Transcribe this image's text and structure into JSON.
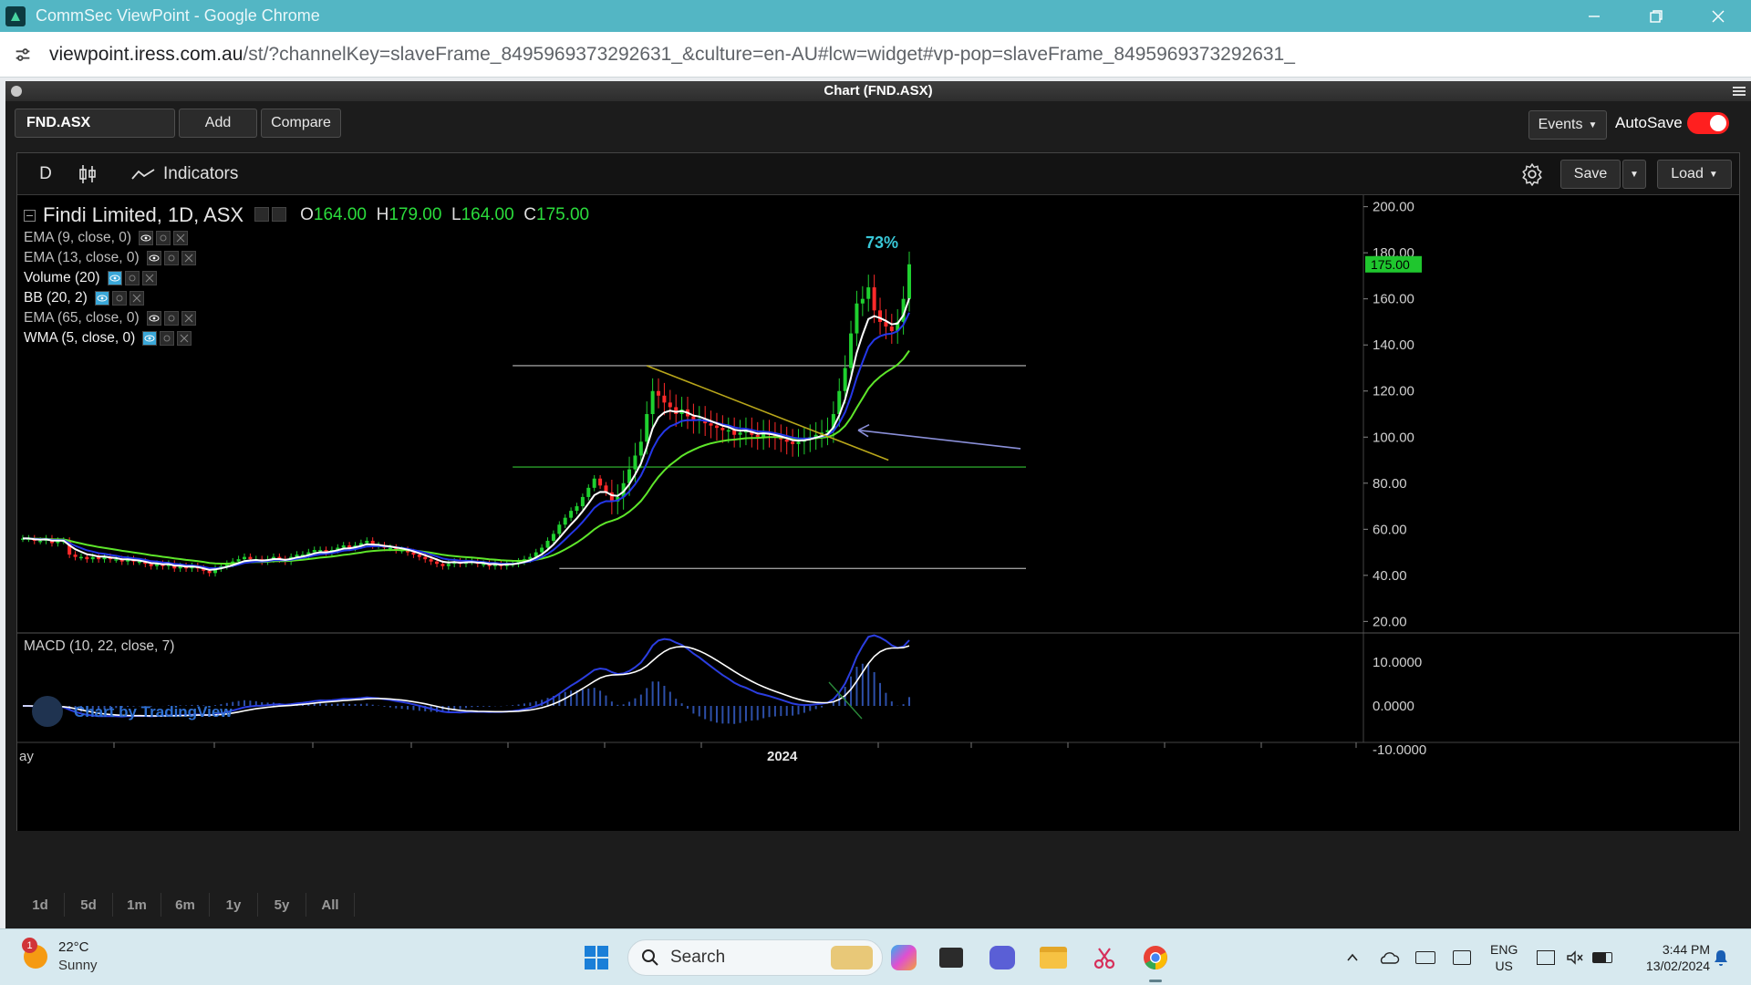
{
  "window": {
    "title": "CommSec ViewPoint - Google Chrome",
    "url_host": "viewpoint.iress.com.au",
    "url_path": "/st/?channelKey=slaveFrame_8495969373292631_&culture=en-AU#lcw=widget#vp-pop=slaveFrame_8495969373292631_"
  },
  "panel": {
    "title": "Chart (FND.ASX)"
  },
  "toolbar": {
    "symbol_value": "FND.ASX",
    "add_label": "Add",
    "compare_label": "Compare",
    "events_label": "Events",
    "autosave_label": "AutoSave",
    "autosave_on": true,
    "interval_label": "D",
    "indicators_label": "Indicators",
    "save_label": "Save",
    "load_label": "Load"
  },
  "legend": {
    "instrument": "Findi Limited, 1D, ASX",
    "ohlc": {
      "o_label": "O",
      "o": "164.00",
      "h_label": "H",
      "h": "179.00",
      "l_label": "L",
      "l": "164.00",
      "c_label": "C",
      "c": "175.00"
    },
    "indicators": [
      {
        "label": "EMA (9, close, 0)",
        "visible": false
      },
      {
        "label": "EMA (13, close, 0)",
        "visible": false
      },
      {
        "label": "Volume (20)",
        "visible": true
      },
      {
        "label": "BB (20, 2)",
        "visible": true
      },
      {
        "label": "EMA (65, close, 0)",
        "visible": false
      },
      {
        "label": "WMA (5, close, 0)",
        "visible": true
      }
    ],
    "macd_label": "MACD (10, 22, close, 7)"
  },
  "chart_data": {
    "type": "candlestick",
    "price_axis": {
      "ticks": [
        "200.00",
        "180.00",
        "160.00",
        "140.00",
        "120.00",
        "100.00",
        "80.00",
        "60.00",
        "40.00",
        "20.00"
      ],
      "range": [
        15,
        205
      ]
    },
    "last_price_label": "175.00",
    "annotation": "73%",
    "macd_axis": {
      "ticks": [
        "10.0000",
        "0.0000",
        "-10.0000"
      ]
    },
    "time_axis": {
      "labels": [
        "ay",
        "2024"
      ]
    },
    "watermark": "Chart by TradingView",
    "horizontal_levels": [
      131,
      87,
      43
    ],
    "trendline": {
      "from": 131,
      "to": 90
    },
    "colors": {
      "up": "#1fd02f",
      "down": "#ff2a2a",
      "ema_fast": "#ffffff",
      "ema_slow": "#2437e8",
      "ema_long": "#5ee62a",
      "hline": "#9a9a9a",
      "green_line": "#2aa02a",
      "trend": "#b8a61a",
      "arrow": "#8a8fd8",
      "pct": "#39c8d8"
    },
    "closes": [
      56,
      56,
      55,
      55,
      56,
      54,
      55,
      55,
      49,
      48,
      48,
      47,
      48,
      47,
      48,
      47,
      47,
      46,
      47,
      46,
      46,
      45,
      44,
      45,
      44,
      45,
      43,
      44,
      43,
      44,
      43,
      42,
      41,
      43,
      44,
      45,
      46,
      47,
      48,
      47,
      47,
      46,
      47,
      48,
      47,
      46,
      48,
      49,
      49,
      50,
      51,
      51,
      50,
      51,
      52,
      53,
      52,
      53,
      54,
      55,
      53,
      53,
      52,
      52,
      51,
      51,
      50,
      49,
      48,
      47,
      46,
      45,
      44,
      45,
      46,
      45,
      46,
      46,
      45,
      45,
      44,
      45,
      44,
      45,
      45,
      46,
      47,
      48,
      50,
      52,
      55,
      58,
      62,
      65,
      68,
      70,
      74,
      78,
      82,
      79,
      76,
      72,
      74,
      80,
      86,
      92,
      98,
      110,
      120,
      118,
      115,
      113,
      110,
      112,
      109,
      107,
      108,
      106,
      105,
      104,
      103,
      103,
      101,
      102,
      103,
      101,
      100,
      102,
      101,
      100,
      99,
      98,
      97,
      98,
      99,
      100,
      101,
      102,
      103,
      110,
      120,
      130,
      145,
      158,
      160,
      165,
      155,
      150,
      148,
      146,
      150,
      160,
      175
    ]
  },
  "range_buttons": [
    "1d",
    "5d",
    "1m",
    "6m",
    "1y",
    "5y",
    "All"
  ],
  "taskbar": {
    "weather_temp": "22°C",
    "weather_desc": "Sunny",
    "weather_badge": "1",
    "search_label": "Search",
    "lang1": "ENG",
    "lang2": "US",
    "time": "3:44 PM",
    "date": "13/02/2024"
  }
}
